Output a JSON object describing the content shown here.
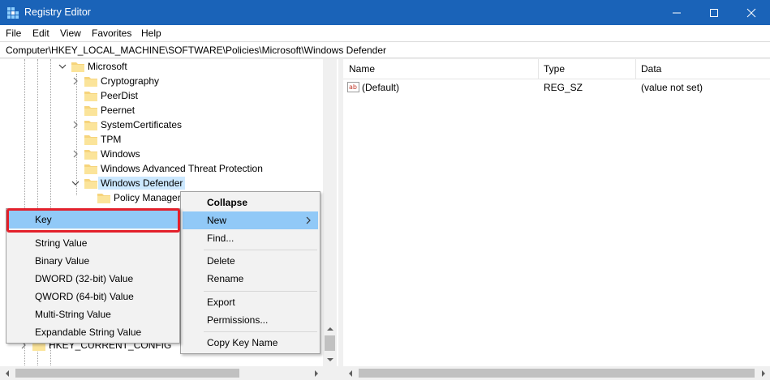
{
  "window": {
    "title": "Registry Editor"
  },
  "menubar": {
    "items": [
      "File",
      "Edit",
      "View",
      "Favorites",
      "Help"
    ]
  },
  "address": {
    "path": "Computer\\HKEY_LOCAL_MACHINE\\SOFTWARE\\Policies\\Microsoft\\Windows Defender"
  },
  "tree": {
    "microsoft": "Microsoft",
    "cryptography": "Cryptography",
    "peerdist": "PeerDist",
    "peernet": "Peernet",
    "systemcertificates": "SystemCertificates",
    "tpm": "TPM",
    "windows": "Windows",
    "watp": "Windows Advanced Threat Protection",
    "windows_defender": "Windows Defender",
    "policy_manager": "Policy Manager",
    "hkcc": "HKEY_CURRENT_CONFIG"
  },
  "list": {
    "columns": {
      "name": "Name",
      "type": "Type",
      "data": "Data"
    },
    "rows": [
      {
        "name": "(Default)",
        "type": "REG_SZ",
        "data": "(value not set)"
      }
    ]
  },
  "context_menu": {
    "collapse": "Collapse",
    "new": "New",
    "find": "Find...",
    "delete": "Delete",
    "rename": "Rename",
    "export": "Export",
    "permissions": "Permissions...",
    "copy_key_name": "Copy Key Name"
  },
  "submenu": {
    "key": "Key",
    "string_value": "String Value",
    "binary_value": "Binary Value",
    "dword_value": "DWORD (32-bit) Value",
    "qword_value": "QWORD (64-bit) Value",
    "multi_string_value": "Multi-String Value",
    "expandable_string_value": "Expandable String Value"
  },
  "colors": {
    "titlebar": "#1a63b8",
    "selection": "#cce8ff",
    "menu_highlight": "#91c9f7",
    "highlight_box": "#e3202b",
    "folder": "#f6d47c"
  }
}
